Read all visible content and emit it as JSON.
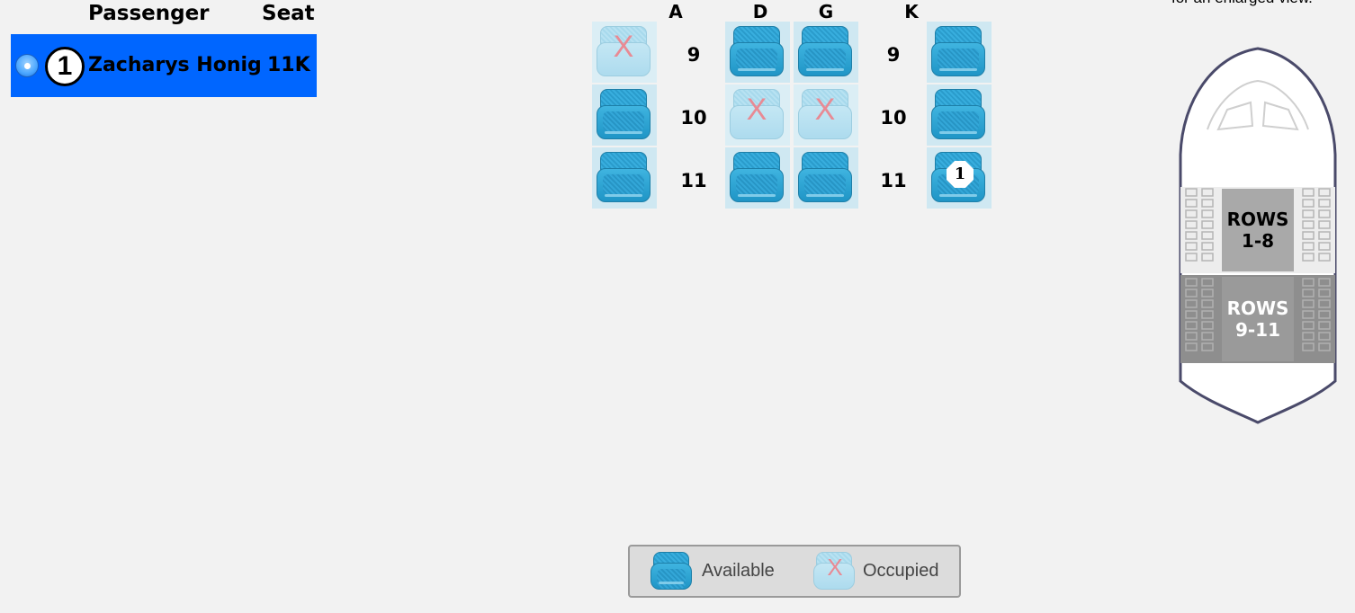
{
  "passenger_panel": {
    "header_passenger": "Passenger",
    "header_seat": "Seat",
    "passengers": [
      {
        "number": "1",
        "name": "Zacharys Honig",
        "seat": "11K",
        "selected": true
      }
    ]
  },
  "seat_map": {
    "columns": [
      "A",
      "D",
      "G",
      "K"
    ],
    "rows": [
      {
        "row": "9",
        "seats": {
          "A": "occupied",
          "D": "available",
          "G": "available",
          "K": "available"
        }
      },
      {
        "row": "10",
        "seats": {
          "A": "available",
          "D": "occupied",
          "G": "occupied",
          "K": "available"
        }
      },
      {
        "row": "11",
        "seats": {
          "A": "available",
          "D": "available",
          "G": "available",
          "K": "assigned",
          "K_badge": "1"
        }
      }
    ],
    "occupied_mark": "X"
  },
  "legend": {
    "available_label": "Available",
    "occupied_label": "Occupied",
    "occupied_mark": "X"
  },
  "overview": {
    "hint_text": "for an enlarged view.",
    "sections": [
      {
        "line1": "ROWS",
        "line2": "1-8",
        "active": false
      },
      {
        "line1": "ROWS",
        "line2": "9-11",
        "active": true
      }
    ]
  },
  "colors": {
    "selected_row": "#0066ff",
    "seat_available": "#2a9ccc",
    "seat_occupied": "#b8e2f2",
    "occupied_x": "#e88a94",
    "background": "#f2f2f2"
  }
}
